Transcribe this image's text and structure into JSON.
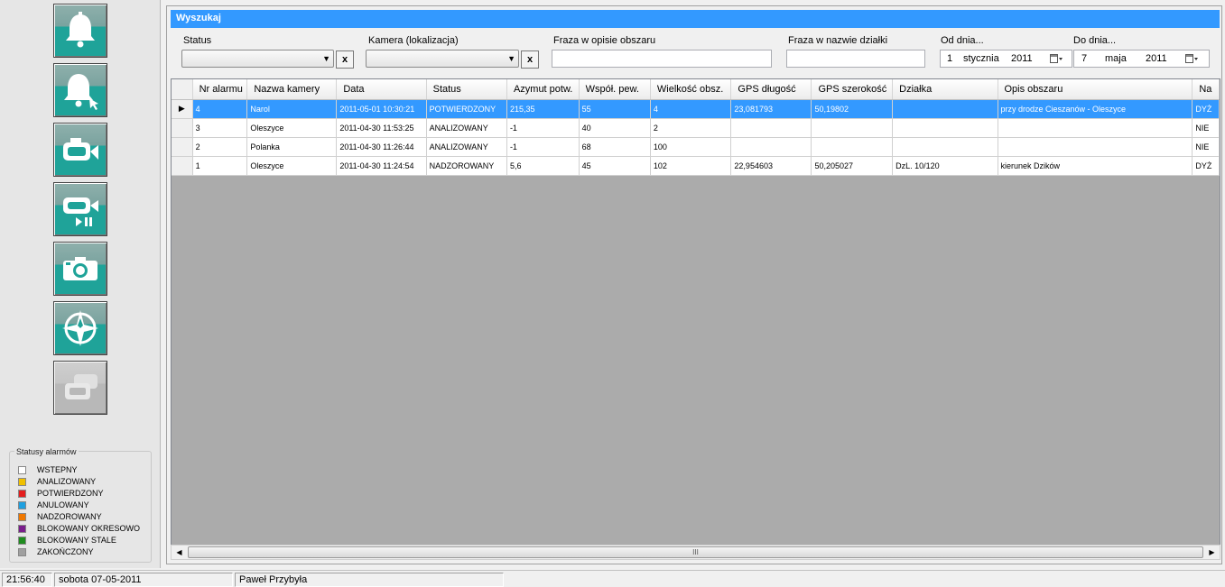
{
  "legend": {
    "title": "Statusy alarmów",
    "items": [
      {
        "label": "WSTEPNY",
        "color": "#ffffff"
      },
      {
        "label": "ANALIZOWANY",
        "color": "#f0c000"
      },
      {
        "label": "POTWIERDZONY",
        "color": "#e41e1e"
      },
      {
        "label": "ANULOWANY",
        "color": "#1ea0e0"
      },
      {
        "label": "NADZOROWANY",
        "color": "#f07800"
      },
      {
        "label": "BLOKOWANY OKRESOWO",
        "color": "#7a1e8c"
      },
      {
        "label": "BLOKOWANY STALE",
        "color": "#1e8c1e"
      },
      {
        "label": "ZAKOŃCZONY",
        "color": "#a0a0a0"
      }
    ]
  },
  "sidebar": {
    "buttons": [
      {
        "icon": "bell-icon"
      },
      {
        "icon": "bell-cursor-icon"
      },
      {
        "icon": "camera-icon"
      },
      {
        "icon": "camera-playback-icon"
      },
      {
        "icon": "photo-camera-icon"
      },
      {
        "icon": "compass-icon"
      },
      {
        "icon": "multi-camera-icon",
        "disabled": true
      }
    ]
  },
  "search": {
    "title": "Wyszukaj",
    "status_label": "Status",
    "camera_label": "Kamera (lokalizacja)",
    "phrase_area_label": "Fraza w opisie obszaru",
    "phrase_plot_label": "Fraza w nazwie działki",
    "from_label": "Od dnia...",
    "to_label": "Do dnia...",
    "clear_label": "x",
    "from_date": {
      "day": "1",
      "month": "stycznia",
      "year": "2011"
    },
    "to_date": {
      "day": "7",
      "month": "maja",
      "year": "2011"
    }
  },
  "grid": {
    "columns": [
      "Nr alarmu",
      "Nazwa kamery",
      "Data",
      "Status",
      "Azymut potw.",
      "Współ. pew.",
      "Wielkość obsz.",
      "GPS długość",
      "GPS szerokość",
      "Działka",
      "Opis obszaru",
      "Na"
    ],
    "rows": [
      [
        "4",
        "Narol",
        "2011-05-01 10:30:21",
        "POTWIERDZONY",
        "215,35",
        "55",
        "4",
        "23,081793",
        "50,19802",
        "",
        "przy drodze Cieszanów - Oleszyce",
        "DYŻ"
      ],
      [
        "3",
        "Oleszyce",
        "2011-04-30 11:53:25",
        "ANALIZOWANY",
        "-1",
        "40",
        "2",
        "",
        "",
        "",
        "",
        "NIE"
      ],
      [
        "2",
        "Polanka",
        "2011-04-30 11:26:44",
        "ANALIZOWANY",
        "-1",
        "68",
        "100",
        "",
        "",
        "",
        "",
        "NIE"
      ],
      [
        "1",
        "Oleszyce",
        "2011-04-30 11:24:54",
        "NADZOROWANY",
        "5,6",
        "45",
        "102",
        "22,954603",
        "50,205027",
        "DzL. 10/120",
        "kierunek Dzików",
        "DYŻ"
      ]
    ],
    "selected_row": 0
  },
  "statusbar": {
    "time": "21:56:40",
    "date": "sobota 07-05-2011",
    "user": "Paweł Przybyła"
  }
}
